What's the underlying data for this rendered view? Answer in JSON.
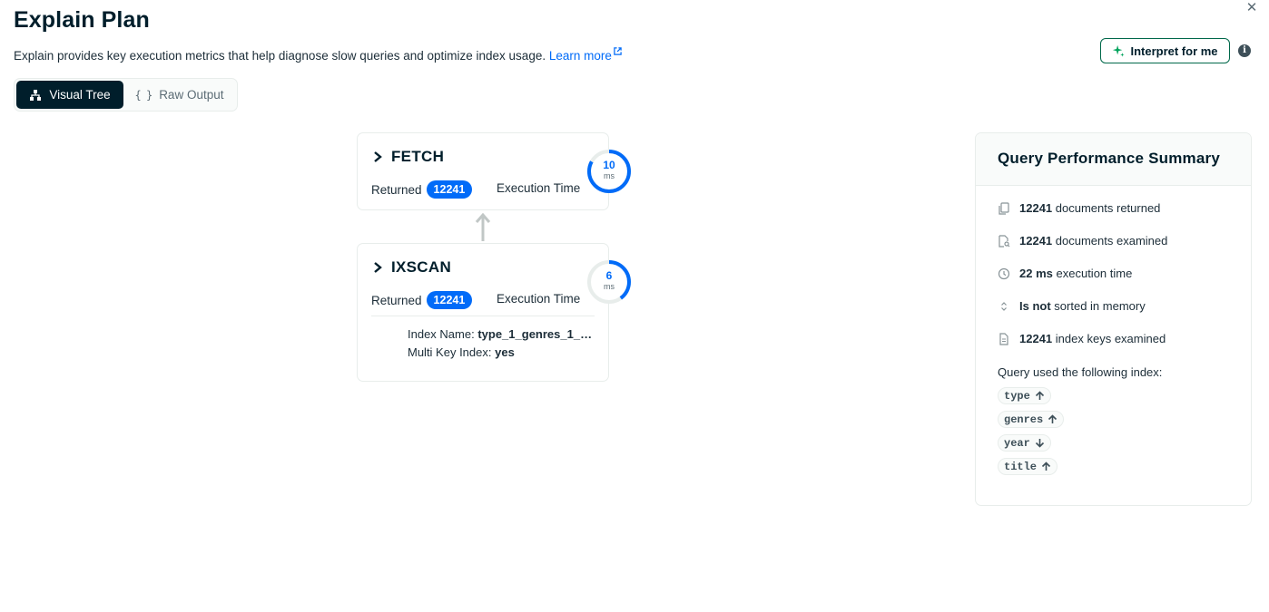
{
  "header": {
    "title": "Explain Plan",
    "description": "Explain provides key execution metrics that help diagnose slow queries and optimize index usage.",
    "learn_more": "Learn more",
    "close_icon": "close-icon"
  },
  "actions": {
    "interpret_label": "Interpret for me"
  },
  "view_toggle": {
    "visual_tree": "Visual Tree",
    "raw_output": "Raw Output",
    "selected": "Visual Tree"
  },
  "stages": [
    {
      "name": "FETCH",
      "returned_label": "Returned",
      "returned": "12241",
      "exec_label": "Execution Time",
      "time": "10",
      "unit": "ms",
      "time_fraction": 0.83
    },
    {
      "name": "IXSCAN",
      "returned_label": "Returned",
      "returned": "12241",
      "exec_label": "Execution Time",
      "time": "6",
      "unit": "ms",
      "time_fraction": 0.4,
      "index_name_label": "Index Name:",
      "index_name": "type_1_genres_1_y...",
      "multi_key_label": "Multi Key Index:",
      "multi_key": "yes"
    }
  ],
  "summary": {
    "title": "Query Performance Summary",
    "docs_returned": "12241",
    "docs_returned_text": "documents returned",
    "docs_examined": "12241",
    "docs_examined_text": "documents examined",
    "exec_time": "22 ms",
    "exec_time_text": "execution time",
    "sorted": "Is not",
    "sorted_text": "sorted in memory",
    "keys_examined": "12241",
    "keys_examined_text": "index keys examined",
    "index_label": "Query used the following index:",
    "index_fields": [
      {
        "name": "type",
        "direction": "up"
      },
      {
        "name": "genres",
        "direction": "up"
      },
      {
        "name": "year",
        "direction": "down"
      },
      {
        "name": "title",
        "direction": "up"
      }
    ]
  },
  "colors": {
    "accent_blue": "#016bf8",
    "dark": "#001e2b",
    "green": "#00684a",
    "border": "#e8edeb"
  }
}
